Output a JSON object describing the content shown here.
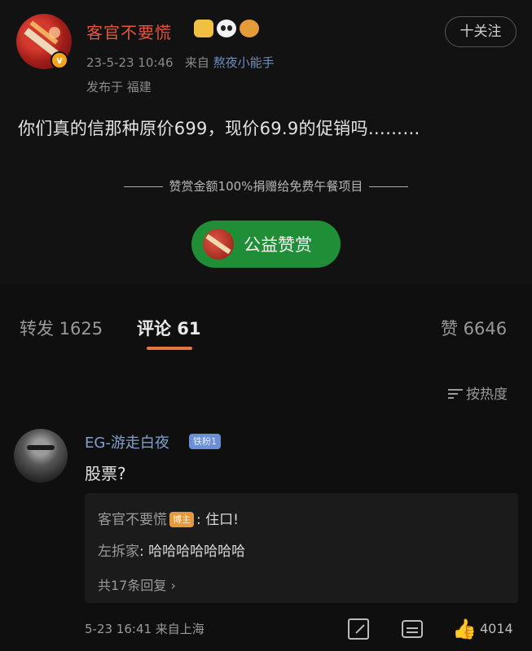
{
  "post": {
    "username": "客官不要慌",
    "date": "23-5-23 10:46",
    "source_prefix": "来自",
    "source": "熬夜小能手",
    "location": "发布于 福建",
    "follow_label": "十关注",
    "text": "你们真的信那种原价699，现价69.9的促销吗………",
    "reward_note": "赞赏金额100%捐赠给免费午餐项目",
    "reward_button": "公益赞赏"
  },
  "tabs": {
    "repost": "转发 1625",
    "comments": "评论 61",
    "likes": "赞 6646"
  },
  "sort_label": "按热度",
  "comment": {
    "name": "EG-游走白夜",
    "badge": "铁粉1",
    "text": "股票?",
    "replies": [
      {
        "name": "客官不要慌",
        "badge": "博主",
        "text": ": 住口!"
      },
      {
        "name": "左拆家",
        "badge": "",
        "text": ": 哈哈哈哈哈哈哈"
      }
    ],
    "more_replies": "共17条回复 ›",
    "meta": "5-23 16:41 来自上海",
    "like_count": "4014"
  },
  "icons": {
    "vip": "verified-v-icon",
    "crown": "crown-icon",
    "panda": "panda-icon",
    "tiger": "tiger-icon",
    "share": "share-icon",
    "comment": "comment-icon",
    "like": "thumbs-up-icon",
    "sort": "sort-icon"
  },
  "colors": {
    "username": "#e8543a",
    "link": "#7fa1d0",
    "reward_button": "#1f8e36",
    "tab_underline": "#e8763a"
  }
}
